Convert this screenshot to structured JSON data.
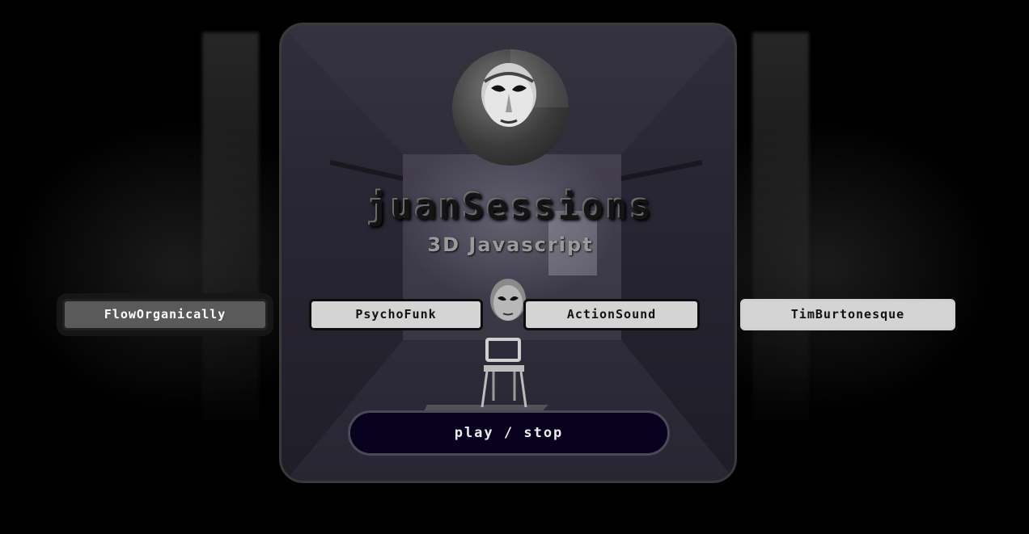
{
  "header": {
    "title": "juanSessions",
    "subtitle": "3D Javascript"
  },
  "buttons": {
    "flow": "FlowOrganically",
    "psycho": "PsychoFunk",
    "action": "ActionSound",
    "tim": "TimBurtonesque",
    "play": "play / stop"
  },
  "colors": {
    "active_button": "#5a5a5a",
    "button": "#d4d4d4",
    "play_button": "#07011e",
    "panel_border": "#3a3a3d"
  },
  "icons": {
    "avatar": "face-mask-avatar",
    "small_face": "face-mask-icon",
    "chair": "chair-illustration"
  }
}
